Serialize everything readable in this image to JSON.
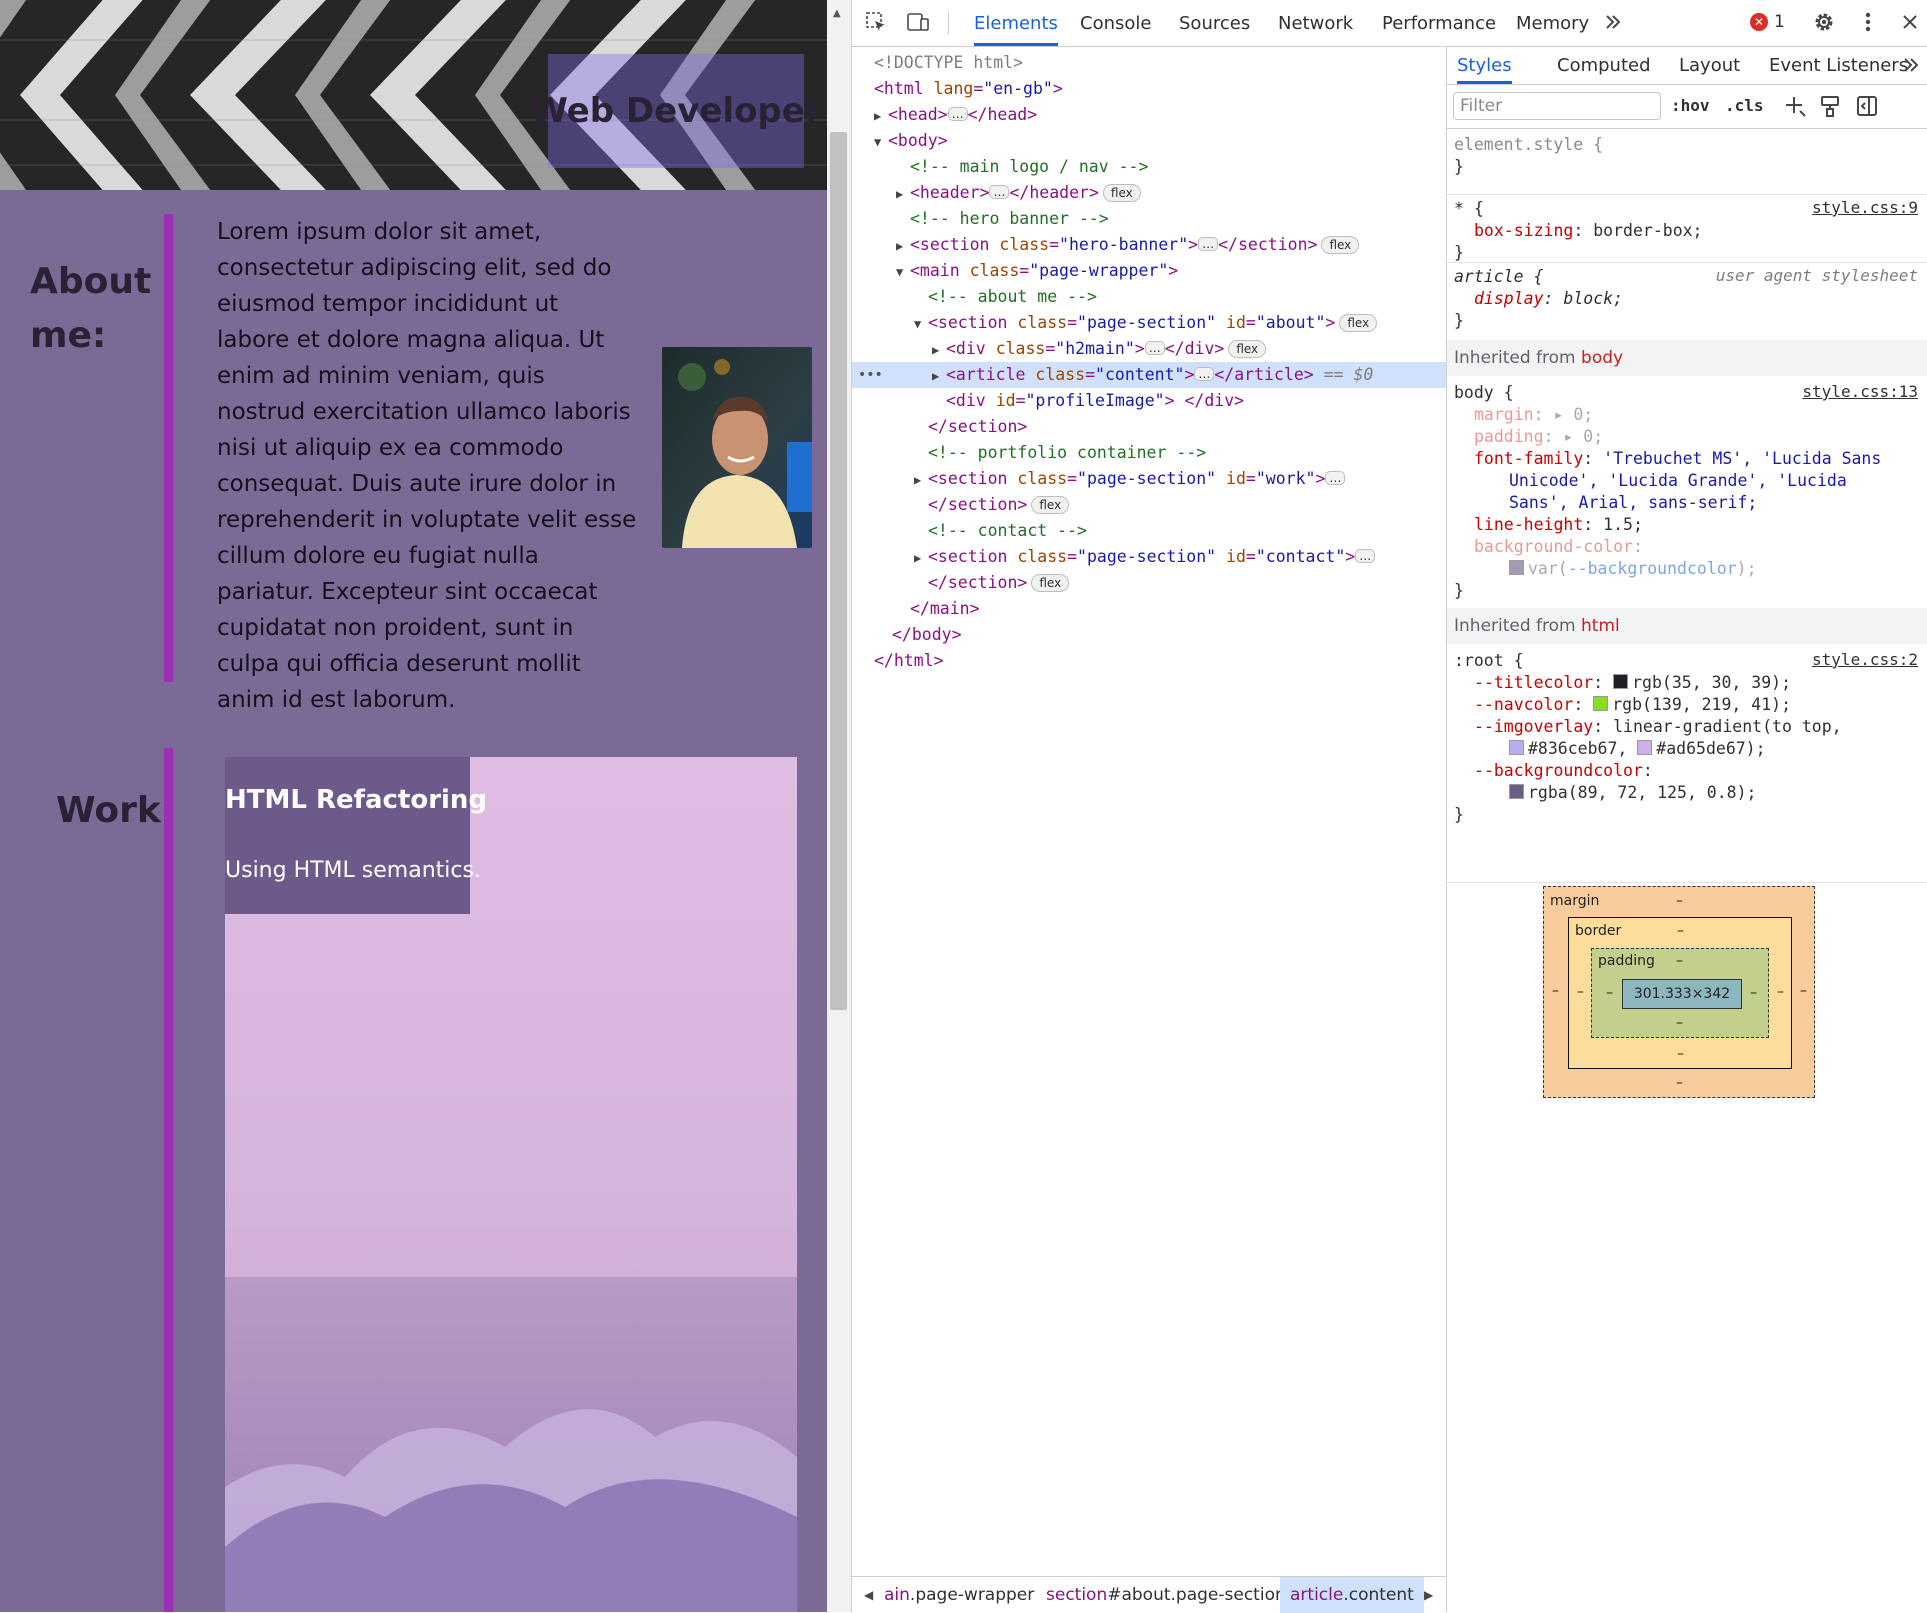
{
  "page": {
    "brand": "Web Developer",
    "about": {
      "heading": "About me:",
      "paragraph": "Lorem ipsum dolor sit amet, consectetur adipiscing elit, sed do eiusmod tempor incididunt ut labore et dolore magna aliqua. Ut enim ad minim veniam, quis nostrud exercitation ullamco laboris nisi ut aliquip ex ea commodo consequat. Duis aute irure dolor in reprehenderit in voluptate velit esse cillum dolore eu fugiat nulla pariatur. Excepteur sint occaecat cupidatat non proident, sunt in culpa qui officia deserunt mollit anim id est laborum."
    },
    "work": {
      "heading": "Work:",
      "card_title": "HTML Refactoring",
      "card_description": "Using HTML semantics."
    },
    "colors": {
      "page_bg": "#7b6a96",
      "accent_bar": "#9b2fb5",
      "brand_overlay": "rgba(131,108,235,0.40)",
      "card_label_bg": "#6e5a8a"
    }
  },
  "devtools": {
    "tabs": [
      "Elements",
      "Console",
      "Sources",
      "Network",
      "Performance",
      "Memory"
    ],
    "active_tab": "Elements",
    "more_tabs_icon": "chevron-double-right-icon",
    "error_count": "1",
    "dom_tree": {
      "doctype": "<!DOCTYPE html>",
      "html_open_tag": "<html",
      "html_attr": "lang",
      "html_attr_val": "\"en-gb\"",
      "head_open": "<head>",
      "head_close": "</head>",
      "body_open": "<body>",
      "comment_nav": "<!-- main logo / nav -->",
      "header_open": "<header>",
      "header_close": "</header>",
      "comment_hero": "<!-- hero banner -->",
      "section_open": "<section",
      "section_close": "</section>",
      "class_attr": "class",
      "id_attr": "id",
      "hero_class": "\"hero-banner\"",
      "main_open": "<main",
      "main_class": "\"page-wrapper\"",
      "comment_about": "<!-- about me -->",
      "page_section_class": "\"page-section\"",
      "about_id": "\"about\"",
      "div_open": "<div",
      "div_close": "</div>",
      "h2main_class": "\"h2main\"",
      "article_open": "<article",
      "article_close": "</article>",
      "content_class": "\"content\"",
      "selected_marker": "== $0",
      "profile_id": "\"profileImage\"",
      "comment_portfolio": "<!-- portfolio container -->",
      "work_id": "\"work\"",
      "comment_contact": "<!-- contact -->",
      "contact_id": "\"contact\"",
      "main_close": "</main>",
      "body_close": "</body>",
      "html_close": "</html>",
      "flex_badge": "flex",
      "ellipsis": "…",
      "gt": ">",
      "eq": "=",
      "space": " "
    },
    "breadcrumbs": [
      {
        "tag": "ain",
        "rest": ".page-wrapper"
      },
      {
        "tag": "section",
        "rest": "#about.page-section"
      },
      {
        "tag": "article",
        "rest": ".content"
      }
    ],
    "styles": {
      "tabs": [
        "Styles",
        "Computed",
        "Layout",
        "Event Listeners"
      ],
      "active_tab": "Styles",
      "filter_placeholder": "Filter",
      "hov_label": ":hov",
      "cls_label": ".cls",
      "element_style_selector": "element.style {",
      "close_brace": "}",
      "universal_selector": "* {",
      "universal_source": "style.css:9",
      "box_sizing_name": "box-sizing",
      "box_sizing_value": "border-box;",
      "article_selector": "article {",
      "article_source": "user agent stylesheet",
      "display_name": "display",
      "display_value": "block;",
      "inherited_body_label": "Inherited from",
      "inherited_body_link": "body",
      "body_selector": "body {",
      "body_source": "style.css:13",
      "margin_name": "margin",
      "margin_value": "0;",
      "padding_name": "padding",
      "padding_value": "0;",
      "font_family_name": "font-family",
      "font_family_value_1": "'Trebuchet MS', 'Lucida Sans",
      "font_family_value_2": "Unicode', 'Lucida Grande', 'Lucida",
      "font_family_value_3": "Sans', Arial, sans-serif;",
      "line_height_name": "line-height",
      "line_height_value": "1.5;",
      "bg_color_name": "background-color",
      "bg_color_value_fn": "var(",
      "bg_color_value_var": "--backgroundcolor",
      "bg_color_value_end": ");",
      "inherited_html_label": "Inherited from",
      "inherited_html_link": "html",
      "root_selector": ":root {",
      "root_source": "style.css:2",
      "titlecolor_name": "--titlecolor",
      "titlecolor_value": "rgb(35, 30, 39);",
      "navcolor_name": "--navcolor",
      "navcolor_value": "rgb(139, 219, 41);",
      "imgoverlay_name": "--imgoverlay",
      "imgoverlay_value_1": "linear-gradient(to top,",
      "imgoverlay_value_2a": "#836ceb67,",
      "imgoverlay_value_2b": "#ad65de67);",
      "backgroundcolor_name": "--backgroundcolor",
      "backgroundcolor_value": "rgba(89, 72, 125, 0.8);",
      "swatches": {
        "bg": "#a39bb0",
        "titlecolor": "#231e27",
        "navcolor": "#8bdb29",
        "overlay_a": "#b7aef2",
        "overlay_b": "#cfaeeb",
        "backgroundcolor": "#6b5e85"
      }
    },
    "box_model": {
      "margin_label": "margin",
      "border_label": "border",
      "padding_label": "padding",
      "content_size": "301.333×342",
      "dash": "–"
    }
  }
}
